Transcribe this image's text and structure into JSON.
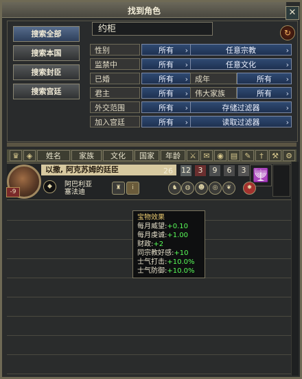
{
  "title": "找到角色",
  "search": {
    "value": "约柜"
  },
  "nav": [
    "搜索全部",
    "搜索本国",
    "搜索封臣",
    "搜索宫廷"
  ],
  "filters": [
    {
      "label": "性别",
      "value": "所有",
      "right": "任意宗教"
    },
    {
      "label": "监禁中",
      "value": "所有",
      "right": "任意文化"
    },
    {
      "label": "已婚",
      "value": "所有",
      "right_label": "成年",
      "right_value": "所有"
    },
    {
      "label": "君主",
      "value": "所有",
      "right_label": "伟大家族",
      "right_value": "所有"
    },
    {
      "label": "外交范围",
      "value": "所有",
      "right": "存储过滤器"
    },
    {
      "label": "加入宫廷",
      "value": "所有",
      "right": "读取过滤器"
    }
  ],
  "columns": [
    "姓名",
    "家族",
    "文化",
    "国家",
    "年龄"
  ],
  "row": {
    "rank": "以撒, 阿克苏姆的廷臣",
    "age": "26",
    "stats": [
      "12",
      "3",
      "9",
      "6",
      "3"
    ],
    "name": "阿巴利亚",
    "subtitle": "塞法迪",
    "badge": "-9"
  },
  "tooltip": {
    "title": "宝物效果",
    "lines": [
      {
        "label": "每月威望:",
        "value": "+0.10"
      },
      {
        "label": "每月虔诚:",
        "value": "+1.00"
      },
      {
        "label": "财政:",
        "value": "+2"
      },
      {
        "label": "同宗教好感:",
        "value": "+10"
      },
      {
        "label": "士气打击:",
        "value": "+10.0%"
      },
      {
        "label": "士气防御:",
        "value": "+10.0%"
      }
    ]
  }
}
